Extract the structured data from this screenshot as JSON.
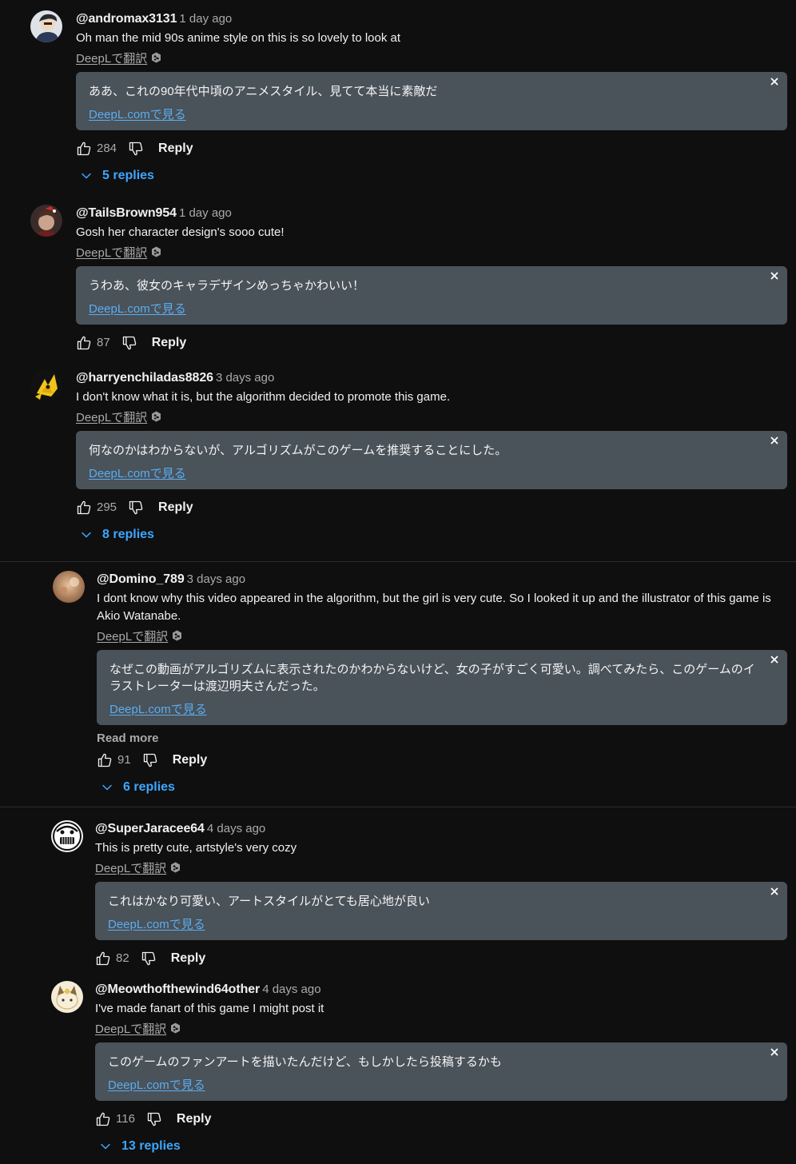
{
  "deepl_label": "DeepLで翻訳",
  "view_on_deepl": "DeepL.comで見る",
  "reply_label": "Reply",
  "read_more": "Read more",
  "colors": {
    "background": "#0f0f0f",
    "translation_box": "#4a525a",
    "replies_link": "#3ea6ff",
    "deepl_link": "#5aaef0"
  },
  "comments": [
    {
      "author": "@andromax3131",
      "time": "1 day ago",
      "text": "Oh man the mid 90s anime style on this is so lovely to look at",
      "translation": "ああ、これの90年代中頃のアニメスタイル、見てて本当に素敵だ",
      "likes": "284",
      "replies": "5 replies",
      "avatar": "avatar-icon"
    },
    {
      "author": "@TailsBrown954",
      "time": "1 day ago",
      "text": "Gosh her character design's sooo cute!",
      "translation": "うわあ、彼女のキャラデザインめっちゃかわいい！",
      "likes": "87",
      "avatar": "avatar-icon"
    },
    {
      "author": "@harryenchiladas8826",
      "time": "3 days ago",
      "text": "I don't know what it is, but the algorithm decided to promote this game.",
      "translation": "何なのかはわからないが、アルゴリズムがこのゲームを推奨することにした。",
      "likes": "295",
      "replies": "8 replies",
      "avatar": "avatar-icon"
    },
    {
      "author": "@Domino_789",
      "time": "3 days ago",
      "text": "I dont know why this video appeared in the algorithm, but the girl is very cute. So I looked it up and the illustrator of this game is Akio Watanabe.",
      "translation": "なぜこの動画がアルゴリズムに表示されたのかわからないけど、女の子がすごく可愛い。調べてみたら、このゲームのイラストレーターは渡辺明夫さんだった。",
      "likes": "91",
      "replies": "6 replies",
      "avatar": "avatar-icon"
    },
    {
      "author": "@SuperJaracee64",
      "time": "4 days ago",
      "text": "This is pretty cute, artstyle's very cozy",
      "translation": "これはかなり可愛い、アートスタイルがとても居心地が良い",
      "likes": "82",
      "avatar": "avatar-icon"
    },
    {
      "author": "@Meowthofthewind64other",
      "time": "4 days ago",
      "text": "I've made fanart of this game I might post it",
      "translation": "このゲームのファンアートを描いたんだけど、もしかしたら投稿するかも",
      "likes": "116",
      "replies": "13 replies",
      "avatar": "avatar-icon"
    }
  ]
}
